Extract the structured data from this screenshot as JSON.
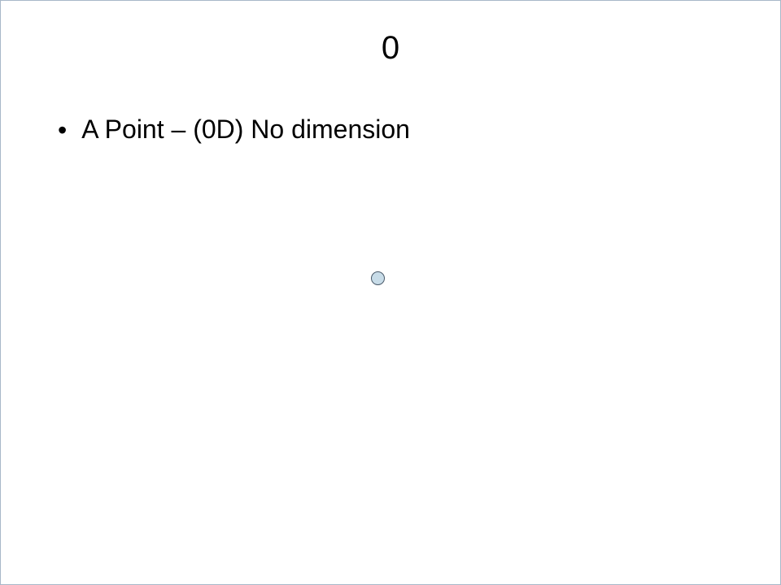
{
  "slide": {
    "title": "0",
    "bullets": [
      {
        "text": "A Point – (0D) No dimension"
      }
    ],
    "shapes": {
      "point": {
        "type": "circle",
        "fill": "#c8dce8",
        "stroke": "#4a5a6a"
      }
    }
  }
}
